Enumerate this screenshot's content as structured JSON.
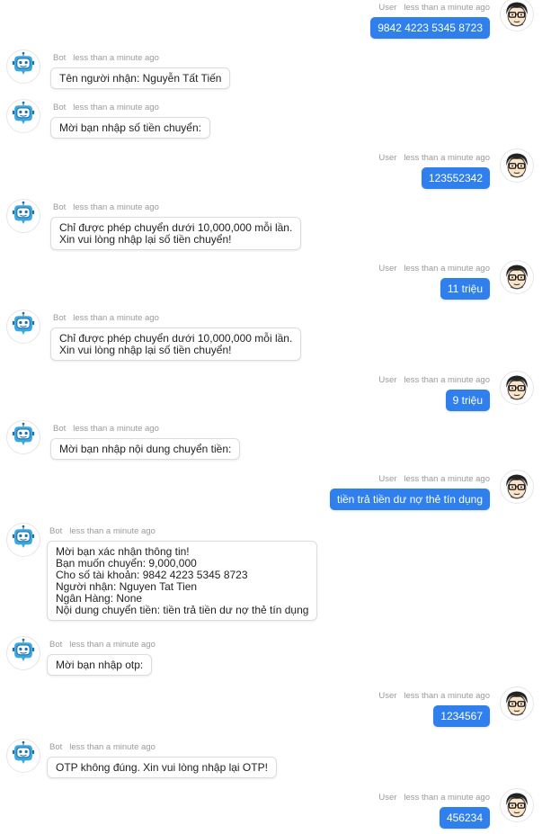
{
  "labels": {
    "bot": "Bot",
    "user": "User",
    "time": "less than a minute ago"
  },
  "messages": [
    {
      "sender": "user",
      "text": "9842 4223 5345 8723"
    },
    {
      "sender": "bot",
      "text": "Tên người nhận: Nguyễn Tất Tiến"
    },
    {
      "sender": "bot",
      "text": "Mời bạn nhập số tiền chuyển:"
    },
    {
      "sender": "user",
      "text": "123552342"
    },
    {
      "sender": "bot",
      "text": "Chỉ được phép chuyển dưới 10,000,000 mỗi lần.\nXin vui lòng nhập lại số tiền chuyển!"
    },
    {
      "sender": "user",
      "text": "11 triệu"
    },
    {
      "sender": "bot",
      "text": "Chỉ được phép chuyển dưới 10,000,000 mỗi lần.\nXin vui lòng nhập lại số tiền chuyển!"
    },
    {
      "sender": "user",
      "text": "9 triệu"
    },
    {
      "sender": "bot",
      "text": "Mời bạn nhập nội dung chuyển tiền:"
    },
    {
      "sender": "user",
      "text": "tiền trả tiền dư nợ thẻ tín dụng"
    },
    {
      "sender": "bot",
      "text": "Mời bạn xác nhận thông tin!\nBạn muốn chuyển: 9,000,000\nCho số tài khoản: 9842 4223 5345 8723\nNgười nhận: Nguyen Tat Tien\nNgân Hàng: None\nNội dung chuyển tiền: tiền trả tiền dư nợ thẻ tín dụng"
    },
    {
      "sender": "bot",
      "text": "Mời bạn nhập otp:"
    },
    {
      "sender": "user",
      "text": "1234567"
    },
    {
      "sender": "bot",
      "text": "OTP không đúng. Xin vui lòng nhập lại OTP!"
    },
    {
      "sender": "user",
      "text": "456234"
    }
  ]
}
